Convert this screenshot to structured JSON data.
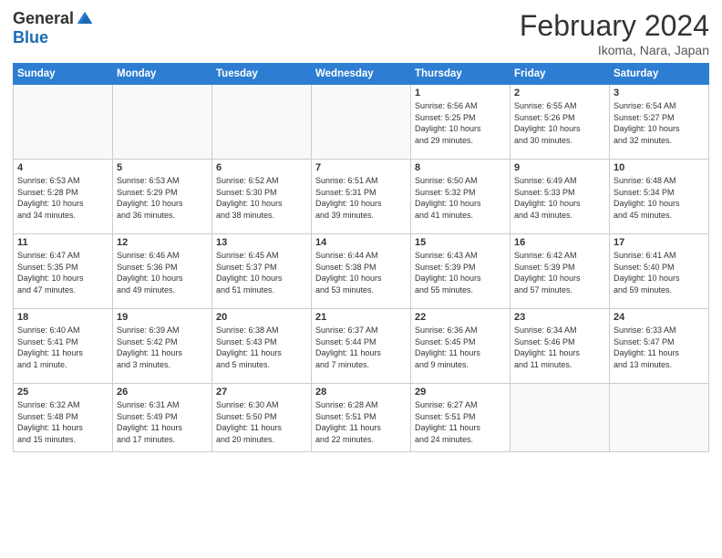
{
  "header": {
    "logo_general": "General",
    "logo_blue": "Blue",
    "month_title": "February 2024",
    "location": "Ikoma, Nara, Japan"
  },
  "weekdays": [
    "Sunday",
    "Monday",
    "Tuesday",
    "Wednesday",
    "Thursday",
    "Friday",
    "Saturday"
  ],
  "weeks": [
    [
      {
        "day": "",
        "info": ""
      },
      {
        "day": "",
        "info": ""
      },
      {
        "day": "",
        "info": ""
      },
      {
        "day": "",
        "info": ""
      },
      {
        "day": "1",
        "info": "Sunrise: 6:56 AM\nSunset: 5:25 PM\nDaylight: 10 hours\nand 29 minutes."
      },
      {
        "day": "2",
        "info": "Sunrise: 6:55 AM\nSunset: 5:26 PM\nDaylight: 10 hours\nand 30 minutes."
      },
      {
        "day": "3",
        "info": "Sunrise: 6:54 AM\nSunset: 5:27 PM\nDaylight: 10 hours\nand 32 minutes."
      }
    ],
    [
      {
        "day": "4",
        "info": "Sunrise: 6:53 AM\nSunset: 5:28 PM\nDaylight: 10 hours\nand 34 minutes."
      },
      {
        "day": "5",
        "info": "Sunrise: 6:53 AM\nSunset: 5:29 PM\nDaylight: 10 hours\nand 36 minutes."
      },
      {
        "day": "6",
        "info": "Sunrise: 6:52 AM\nSunset: 5:30 PM\nDaylight: 10 hours\nand 38 minutes."
      },
      {
        "day": "7",
        "info": "Sunrise: 6:51 AM\nSunset: 5:31 PM\nDaylight: 10 hours\nand 39 minutes."
      },
      {
        "day": "8",
        "info": "Sunrise: 6:50 AM\nSunset: 5:32 PM\nDaylight: 10 hours\nand 41 minutes."
      },
      {
        "day": "9",
        "info": "Sunrise: 6:49 AM\nSunset: 5:33 PM\nDaylight: 10 hours\nand 43 minutes."
      },
      {
        "day": "10",
        "info": "Sunrise: 6:48 AM\nSunset: 5:34 PM\nDaylight: 10 hours\nand 45 minutes."
      }
    ],
    [
      {
        "day": "11",
        "info": "Sunrise: 6:47 AM\nSunset: 5:35 PM\nDaylight: 10 hours\nand 47 minutes."
      },
      {
        "day": "12",
        "info": "Sunrise: 6:46 AM\nSunset: 5:36 PM\nDaylight: 10 hours\nand 49 minutes."
      },
      {
        "day": "13",
        "info": "Sunrise: 6:45 AM\nSunset: 5:37 PM\nDaylight: 10 hours\nand 51 minutes."
      },
      {
        "day": "14",
        "info": "Sunrise: 6:44 AM\nSunset: 5:38 PM\nDaylight: 10 hours\nand 53 minutes."
      },
      {
        "day": "15",
        "info": "Sunrise: 6:43 AM\nSunset: 5:39 PM\nDaylight: 10 hours\nand 55 minutes."
      },
      {
        "day": "16",
        "info": "Sunrise: 6:42 AM\nSunset: 5:39 PM\nDaylight: 10 hours\nand 57 minutes."
      },
      {
        "day": "17",
        "info": "Sunrise: 6:41 AM\nSunset: 5:40 PM\nDaylight: 10 hours\nand 59 minutes."
      }
    ],
    [
      {
        "day": "18",
        "info": "Sunrise: 6:40 AM\nSunset: 5:41 PM\nDaylight: 11 hours\nand 1 minute."
      },
      {
        "day": "19",
        "info": "Sunrise: 6:39 AM\nSunset: 5:42 PM\nDaylight: 11 hours\nand 3 minutes."
      },
      {
        "day": "20",
        "info": "Sunrise: 6:38 AM\nSunset: 5:43 PM\nDaylight: 11 hours\nand 5 minutes."
      },
      {
        "day": "21",
        "info": "Sunrise: 6:37 AM\nSunset: 5:44 PM\nDaylight: 11 hours\nand 7 minutes."
      },
      {
        "day": "22",
        "info": "Sunrise: 6:36 AM\nSunset: 5:45 PM\nDaylight: 11 hours\nand 9 minutes."
      },
      {
        "day": "23",
        "info": "Sunrise: 6:34 AM\nSunset: 5:46 PM\nDaylight: 11 hours\nand 11 minutes."
      },
      {
        "day": "24",
        "info": "Sunrise: 6:33 AM\nSunset: 5:47 PM\nDaylight: 11 hours\nand 13 minutes."
      }
    ],
    [
      {
        "day": "25",
        "info": "Sunrise: 6:32 AM\nSunset: 5:48 PM\nDaylight: 11 hours\nand 15 minutes."
      },
      {
        "day": "26",
        "info": "Sunrise: 6:31 AM\nSunset: 5:49 PM\nDaylight: 11 hours\nand 17 minutes."
      },
      {
        "day": "27",
        "info": "Sunrise: 6:30 AM\nSunset: 5:50 PM\nDaylight: 11 hours\nand 20 minutes."
      },
      {
        "day": "28",
        "info": "Sunrise: 6:28 AM\nSunset: 5:51 PM\nDaylight: 11 hours\nand 22 minutes."
      },
      {
        "day": "29",
        "info": "Sunrise: 6:27 AM\nSunset: 5:51 PM\nDaylight: 11 hours\nand 24 minutes."
      },
      {
        "day": "",
        "info": ""
      },
      {
        "day": "",
        "info": ""
      }
    ]
  ]
}
